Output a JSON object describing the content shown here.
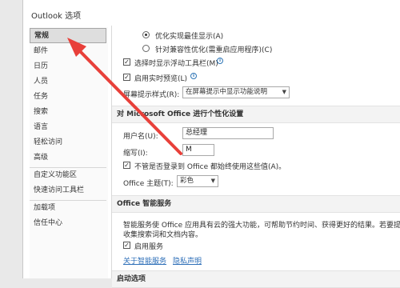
{
  "window": {
    "title": "Outlook 选项"
  },
  "sidebar": {
    "items": [
      {
        "label": "常规"
      },
      {
        "label": "邮件"
      },
      {
        "label": "日历"
      },
      {
        "label": "人员"
      },
      {
        "label": "任务"
      },
      {
        "label": "搜索"
      },
      {
        "label": "语言"
      },
      {
        "label": "轻松访问"
      },
      {
        "label": "高级"
      },
      {
        "label": "自定义功能区"
      },
      {
        "label": "快速访问工具栏"
      },
      {
        "label": "加载项"
      },
      {
        "label": "信任中心"
      }
    ]
  },
  "general": {
    "radio_optimize_display": "优化实现最佳显示(A)",
    "radio_optimize_compat": "针对兼容性优化(需重启应用程序)(C)",
    "show_minitoolbar": "选择时显示浮动工具栏(M)",
    "enable_live_preview": "启用实时预览(L)",
    "screentip_label": "屏幕提示样式(R):",
    "screentip_value": "在屏幕提示中显示功能说明",
    "personalize_header": "对 Microsoft Office 进行个性化设置",
    "username_label": "用户名(U):",
    "username_value": "总经理",
    "initials_label": "缩写(I):",
    "initials_value": "M",
    "always_use_values": "不管是否登录到 Office 都始终使用这些值(A)。",
    "theme_label": "Office 主题(T):",
    "theme_value": "彩色",
    "intelligent_header": "Office 智能服务",
    "intelligent_desc_1": "智能服务使 Office 应用具有云的强大功能，可帮助节约时间、获得更好的结果。若要提供这",
    "intelligent_desc_2": "收集搜索词和文档内容。",
    "enable_services": "启用服务",
    "about_link": "关于智能服务",
    "privacy_link": "隐私声明",
    "startup_header": "启动选项"
  },
  "colors": {
    "annotation_arrow": "#e8403a",
    "link": "#2e6fb8"
  }
}
